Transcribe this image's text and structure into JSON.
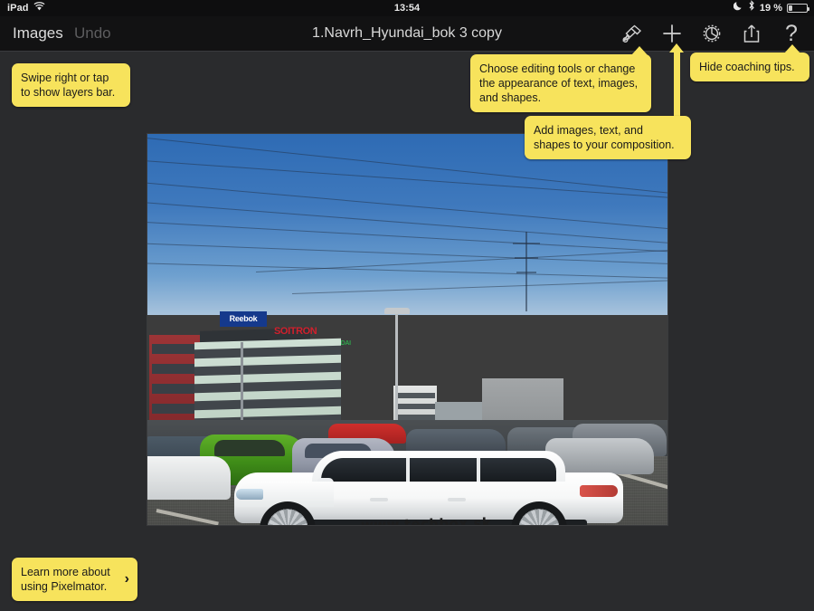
{
  "status_bar": {
    "device": "iPad",
    "wifi_icon": "wifi-icon",
    "time": "13:54",
    "dnd_icon": "moon-icon",
    "bluetooth_icon": "bluetooth-icon",
    "battery_percent": "19 %",
    "battery_icon": "battery-icon"
  },
  "toolbar": {
    "images_label": "Images",
    "undo_label": "Undo",
    "document_title": "1.Navrh_Hyundai_bok 3 copy",
    "icons": [
      {
        "name": "tools-icon",
        "glyph": "paint-tools"
      },
      {
        "name": "add-icon",
        "glyph": "plus"
      },
      {
        "name": "settings-icon",
        "glyph": "gear"
      },
      {
        "name": "share-icon",
        "glyph": "share-arrow-up"
      },
      {
        "name": "help-icon",
        "glyph": "?"
      }
    ]
  },
  "coaching_tips": [
    {
      "id": "layers-tip",
      "text": "Swipe right or tap to show layers bar."
    },
    {
      "id": "tools-tip",
      "text": "Choose editing tools or change the appearance of text, images, and shapes."
    },
    {
      "id": "add-tip",
      "text": "Add images, text, and shapes to your composition."
    },
    {
      "id": "hide-tips-tip",
      "text": "Hide coaching tips."
    },
    {
      "id": "learn-more-tip",
      "text": "Learn more about using Pixelmator.",
      "chevron": "›"
    }
  ],
  "canvas": {
    "artwork_name": "hyundai-i40-parking-lot-photo",
    "car_decal_text": "www.techbox.sk",
    "signs": {
      "blue_sign": "Reebok",
      "red_sign": "SOITRON",
      "green_sign": "HYUNDAI"
    }
  },
  "colors": {
    "tip_yellow": "#f7e35c",
    "toolbar_bg": "#121213",
    "app_bg": "#2a2b2d",
    "status_bg": "#0e0e0f",
    "text_primary": "#dcdcdc",
    "text_disabled": "#5d5d5f"
  }
}
